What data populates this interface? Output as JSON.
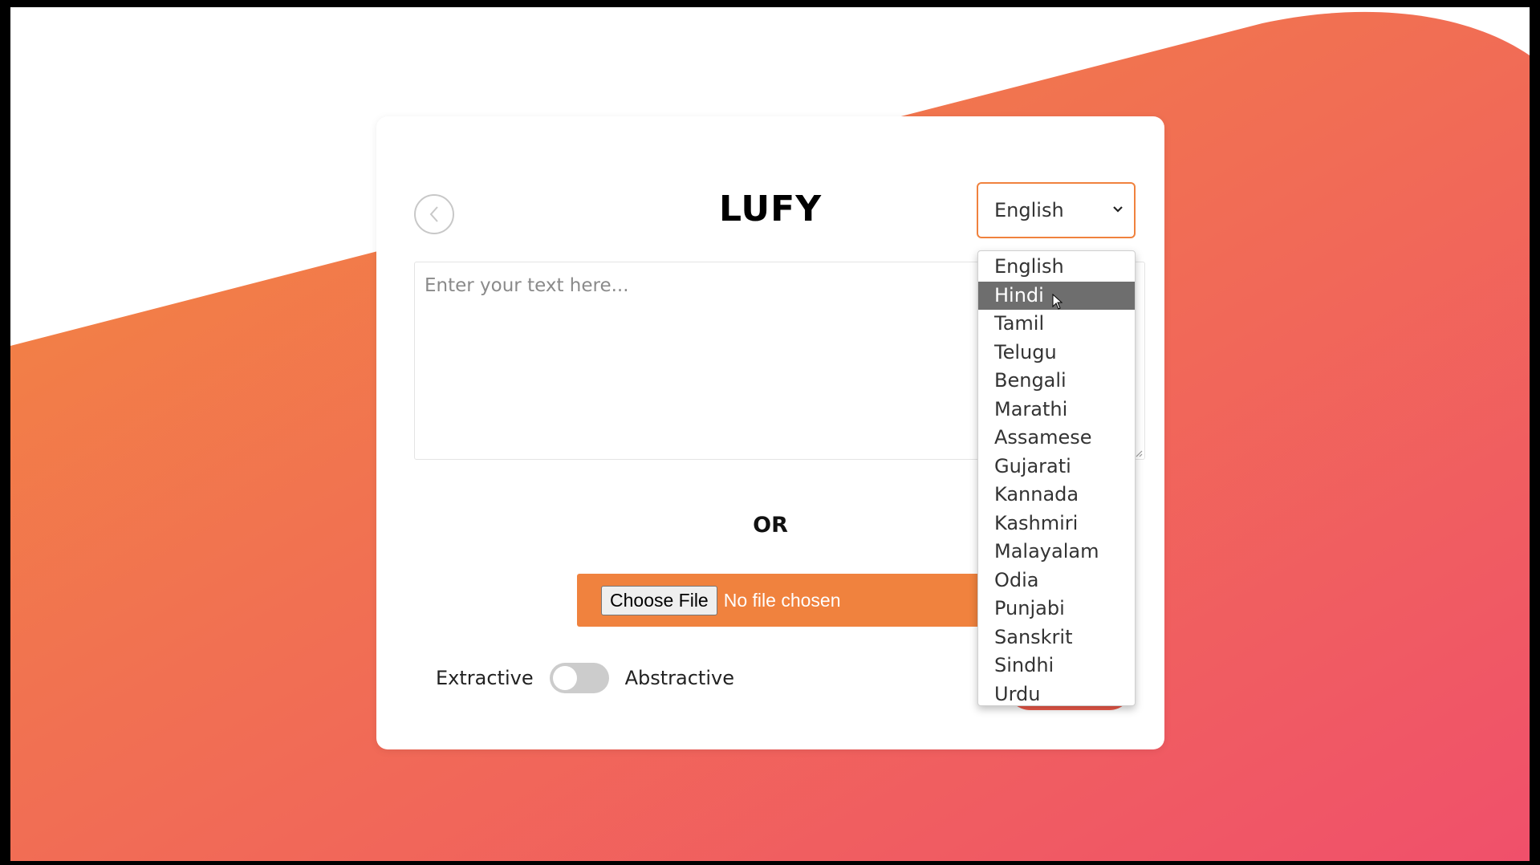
{
  "app": {
    "title": "LUFY"
  },
  "language_select": {
    "selected": "English",
    "highlighted": "Hindi",
    "options": [
      "English",
      "Hindi",
      "Tamil",
      "Telugu",
      "Bengali",
      "Marathi",
      "Assamese",
      "Gujarati",
      "Kannada",
      "Kashmiri",
      "Malayalam",
      "Odia",
      "Punjabi",
      "Sanskrit",
      "Sindhi",
      "Urdu"
    ]
  },
  "text_input": {
    "placeholder": "Enter your text here..."
  },
  "separator": "OR",
  "file_input": {
    "button_label": "Choose File",
    "status": "No file chosen"
  },
  "mode_toggle": {
    "left_label": "Extractive",
    "right_label": "Abstractive",
    "state": "off"
  },
  "icons": {
    "back": "chevron-left-icon",
    "dropdown": "chevron-down-icon",
    "resize": "resize-grip-icon",
    "pointer": "mouse-pointer-icon"
  },
  "colors": {
    "accent": "#f0823e",
    "gradient_start": "#f28440",
    "gradient_end": "#f0516a",
    "highlight": "#6e6e6e"
  }
}
